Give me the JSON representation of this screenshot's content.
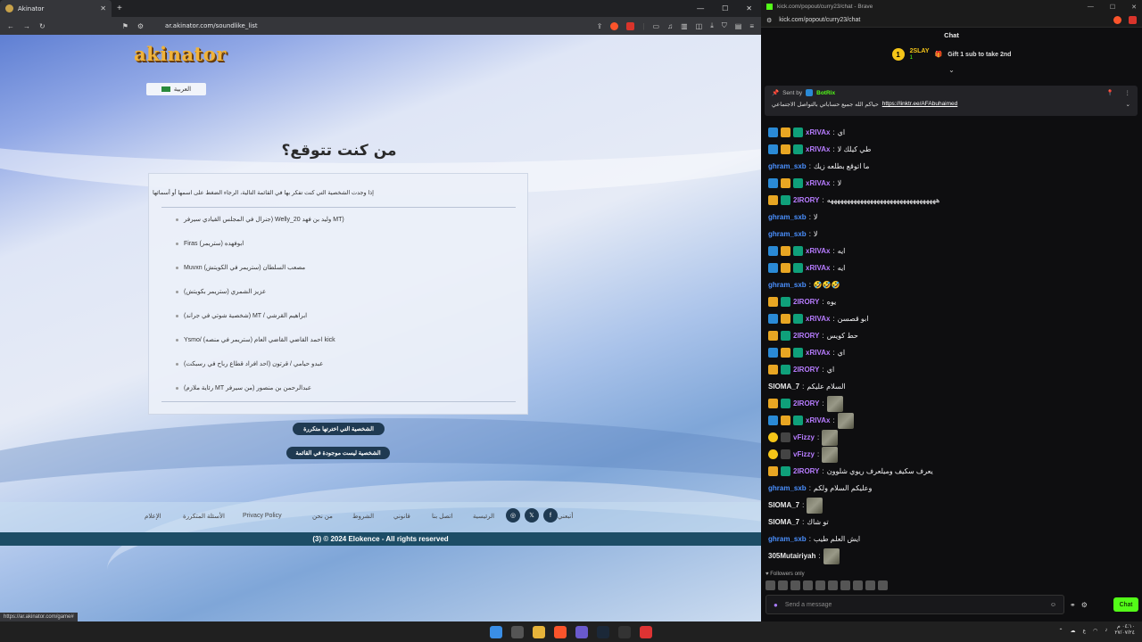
{
  "browser": {
    "tab_title": "Akinator",
    "url": "ar.akinator.com/soundlike_list",
    "status_url": "https://ar.akinator.com/game#"
  },
  "akinator": {
    "logo": "akinator",
    "language_button": "العربية",
    "heading": "من كنت تتوقع؟",
    "intro": "إذا وجدت الشخصية التي كنت تفكر بها في القائمة التالية، الرجاء الضغط على اسمها أو أسمائها",
    "options": [
      "جنرال في المجلس القيادي سيرفر) Welly_20 وليد بن فهد MT)",
      "Firas (ستريمر) ابوفهده",
      "Muvxn مصعب السلطان (ستريمر في الكويتش)",
      "عزيز الشمري (ستريمر بكويتش)",
      "(شخصية شوتي في جراند) MT / ابراهيم القرشي",
      "Ysmo/ احمد القاضي القاضي العام (ستريمر في منصه) kick",
      "عبدو حيامي / قرتون (احد افراد قطاع رباح في رسبكت)",
      "(رئاية ملازم MT من سيرفر) عبدالرحمن بن منصور"
    ],
    "button_repeat": "الشخصية التي اخترتها متكررة",
    "button_not_in_list": "الشخصية ليست موجودة في القائمة",
    "footer_links": [
      "الرئيسية",
      "اتصل بنا",
      "قانوني",
      "الشروط",
      "من نحن",
      "Privacy Policy",
      "الأسئلة المتكررة",
      "الإعلام"
    ],
    "footer_follow": "أتبعني",
    "copyright": "(3)  © 2024 Elokence - All rights reserved"
  },
  "kick": {
    "window_title": "kick.com/popout/curry23/chat - Brave",
    "url": "kick.com/popout/curry23/chat",
    "chat_title": "Chat",
    "gift": {
      "rank": "1",
      "user": "2SLAY",
      "count": "1",
      "text": "Gift 1 sub to take 2nd"
    },
    "pinned": {
      "sent_by": "Sent by",
      "bot": "BotRix",
      "message": "حياكم الله جميع حساباتي بالتواصل الاجتماعي",
      "link": "https://linktr.ee/AFAbuhaimed"
    },
    "messages": [
      {
        "user": "xRIVAx",
        "text": "اي",
        "color": "#b77cff",
        "badges": [
          "mod",
          "crown",
          "sub"
        ]
      },
      {
        "user": "xRIVAx",
        "text": "طي كيلك لا",
        "color": "#b77cff",
        "badges": [
          "mod",
          "crown",
          "sub"
        ]
      },
      {
        "user": "ghram_sxb",
        "text": "ما اتوقع بطلعه زيك",
        "color": "#4a90ff",
        "badges": []
      },
      {
        "user": "xRIVAx",
        "text": "لا",
        "color": "#b77cff",
        "badges": [
          "mod",
          "crown",
          "sub"
        ]
      },
      {
        "user": "2IRORY",
        "text": "هههههههههههههههههههههههههههههههههه",
        "color": "#b77cff",
        "badges": [
          "crown",
          "sub"
        ]
      },
      {
        "user": "ghram_sxb",
        "text": "لا",
        "color": "#4a90ff",
        "badges": []
      },
      {
        "user": "ghram_sxb",
        "text": "لا",
        "color": "#4a90ff",
        "badges": []
      },
      {
        "user": "xRIVAx",
        "text": "ايه",
        "color": "#b77cff",
        "badges": [
          "mod",
          "crown",
          "sub"
        ]
      },
      {
        "user": "xRIVAx",
        "text": "ايه",
        "color": "#b77cff",
        "badges": [
          "mod",
          "crown",
          "sub"
        ]
      },
      {
        "user": "ghram_sxb",
        "text": "🤣🤣🤣",
        "color": "#4a90ff",
        "badges": []
      },
      {
        "user": "2IRORY",
        "text": "يوه",
        "color": "#b77cff",
        "badges": [
          "crown",
          "sub"
        ]
      },
      {
        "user": "xRIVAx",
        "text": "ابو قصسن",
        "color": "#b77cff",
        "badges": [
          "mod",
          "crown",
          "sub"
        ]
      },
      {
        "user": "2IRORY",
        "text": "حط كويس",
        "color": "#b77cff",
        "badges": [
          "crown",
          "sub"
        ]
      },
      {
        "user": "xRIVAx",
        "text": "اي",
        "color": "#b77cff",
        "badges": [
          "mod",
          "crown",
          "sub"
        ]
      },
      {
        "user": "2IRORY",
        "text": "اي",
        "color": "#b77cff",
        "badges": [
          "crown",
          "sub"
        ]
      },
      {
        "user": "SIOMA_7",
        "text": "السلام عليكم",
        "color": "#e8e8e8",
        "badges": []
      },
      {
        "user": "2IRORY",
        "text": "",
        "color": "#b77cff",
        "badges": [
          "crown",
          "sub"
        ],
        "emote": true
      },
      {
        "user": "xRIVAx",
        "text": "",
        "color": "#b77cff",
        "badges": [
          "mod",
          "crown",
          "sub"
        ],
        "emote": true
      },
      {
        "user": "vFizzy",
        "text": "",
        "color": "#b77cff",
        "badges": [
          "circle",
          "tool"
        ],
        "emote": true
      },
      {
        "user": "vFizzy",
        "text": "",
        "color": "#b77cff",
        "badges": [
          "circle",
          "tool"
        ],
        "emote": true
      },
      {
        "user": "2IRORY",
        "text": "يعرف سكيف وميلعرف ريوي شلوون",
        "color": "#b77cff",
        "badges": [
          "crown",
          "sub"
        ]
      },
      {
        "user": "ghram_sxb",
        "text": "وعليكم السلام ولكم",
        "color": "#4a90ff",
        "badges": []
      },
      {
        "user": "SIOMA_7",
        "text": "",
        "color": "#e8e8e8",
        "badges": [],
        "emote": true
      },
      {
        "user": "SIOMA_7",
        "text": "تو شاك",
        "color": "#e8e8e8",
        "badges": []
      },
      {
        "user": "ghram_sxb",
        "text": "ايش العلم طيب",
        "color": "#4a90ff",
        "badges": []
      },
      {
        "user": "305Mutairiyah",
        "text": "",
        "color": "#e8e8e8",
        "badges": [],
        "emote": true
      }
    ],
    "followers_only": "Followers only",
    "input_placeholder": "Send a message",
    "chat_button": "Chat"
  },
  "taskbar": {
    "time": "٠٤:١٠ م",
    "date": "٢٧/٠٧/٢٤",
    "lang": "ع"
  }
}
